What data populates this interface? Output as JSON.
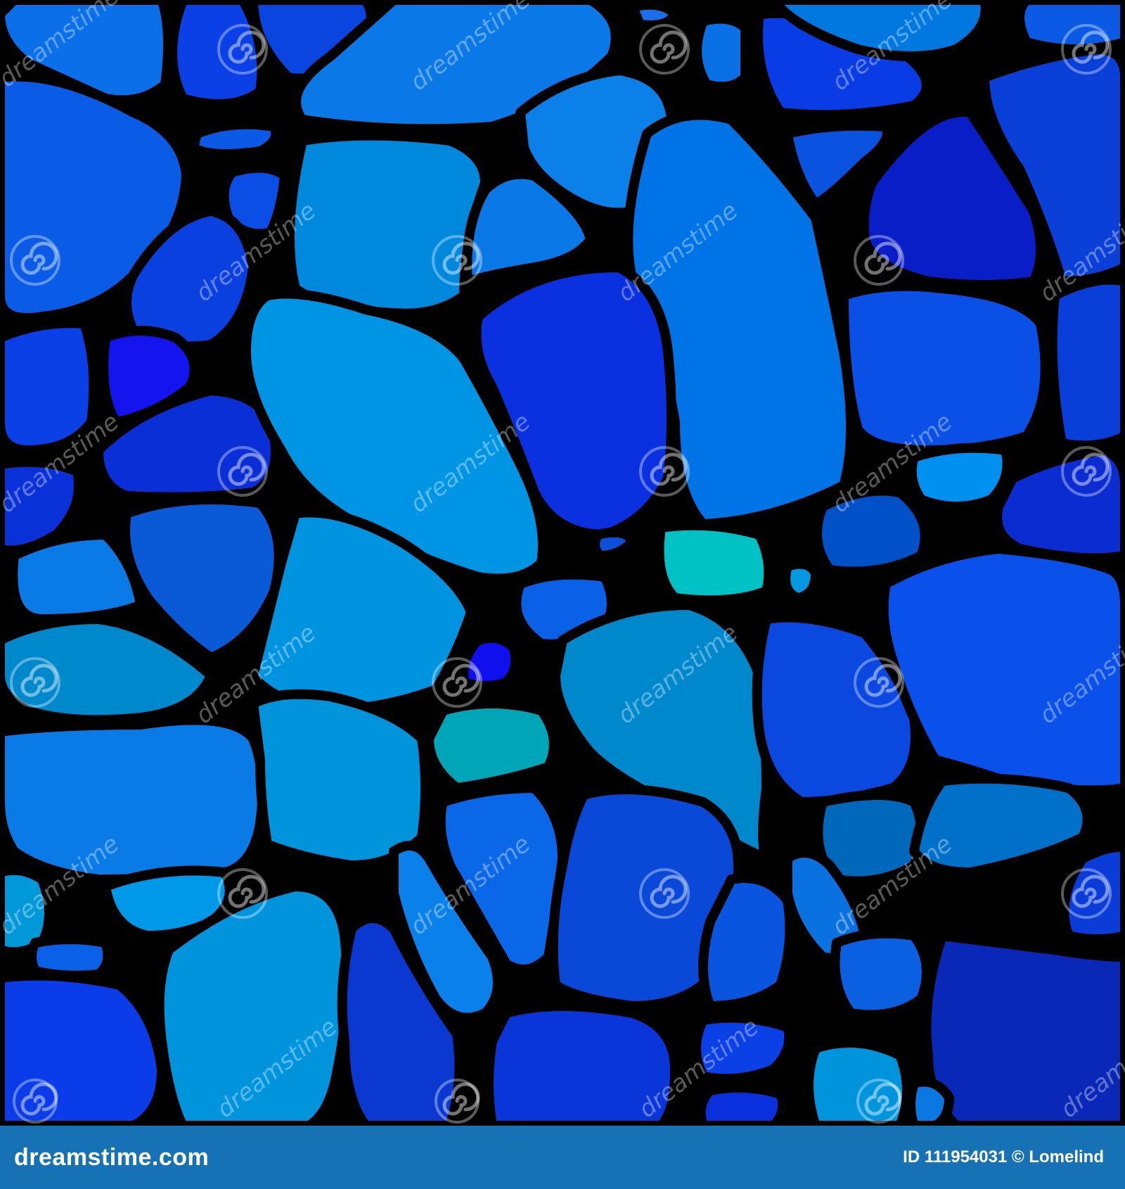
{
  "artwork": {
    "watermark": {
      "text": "dreamstime",
      "icon": "dreamstime-spiral-icon"
    },
    "colors": {
      "background": "#000000",
      "stone_palette": [
        "#0a3cdc",
        "#0a5ae6",
        "#0073e6",
        "#0088e6",
        "#0094e0",
        "#0099dd",
        "#00a0e4",
        "#0a2fd6",
        "#0a1fb8",
        "#1414e8",
        "#0f52d0",
        "#0066bb",
        "#00bfbf",
        "#00a8b8"
      ]
    }
  },
  "footer": {
    "brand": "dreamstime.com",
    "credit": "ID 111954031 © Lomelind",
    "background": "#1672b4"
  }
}
